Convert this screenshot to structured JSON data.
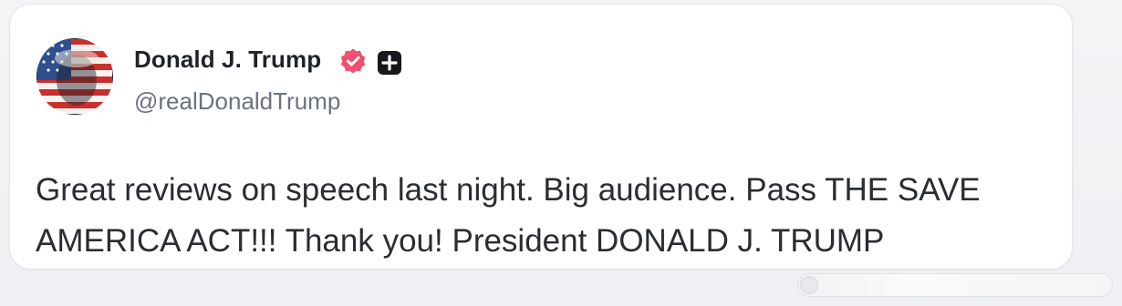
{
  "post": {
    "author": {
      "display_name": "Donald J. Trump",
      "handle": "@realDonaldTrump",
      "avatar_icon": "flag-portrait-avatar",
      "verified_icon": "verified-badge-icon",
      "verified_color": "#f0506e",
      "plus_icon": "plus-badge-icon"
    },
    "text": "Great reviews on speech last night. Big audience. Pass THE SAVE AMERICA ACT!!! Thank you! President DONALD J. TRUMP"
  },
  "colors": {
    "card_background": "#ffffff",
    "page_background": "#eceef1",
    "name_text": "#1f2328",
    "handle_text": "#6b7280",
    "body_text": "#2a2d31"
  }
}
